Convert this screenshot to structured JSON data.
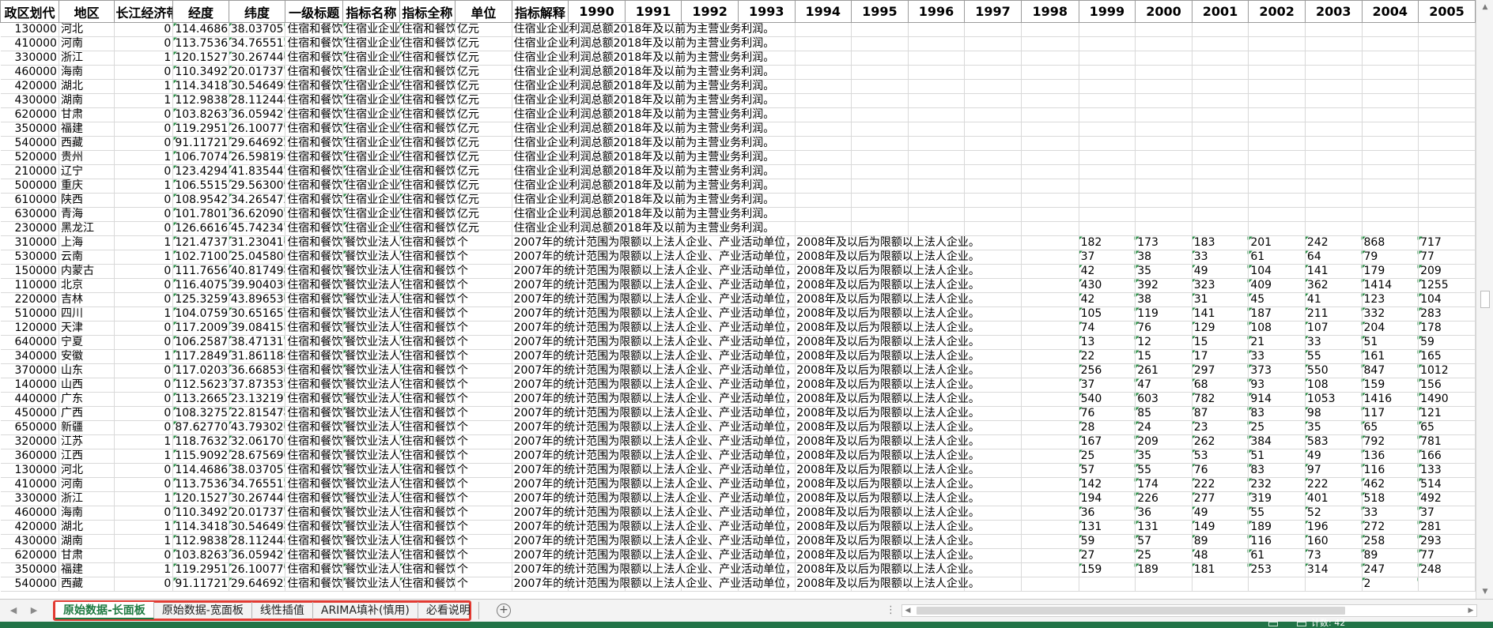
{
  "columns": [
    "政区划代",
    "地区",
    "长江经济带",
    "经度",
    "纬度",
    "一级标题",
    "指标名称",
    "指标全称",
    "单位",
    "指标解释",
    "1990",
    "1991",
    "1992",
    "1993",
    "1994",
    "1995",
    "1996",
    "1997",
    "1998",
    "1999",
    "2000",
    "2001",
    "2002",
    "2003",
    "2004",
    "2005"
  ],
  "rows": [
    [
      "130000",
      "河北",
      "0",
      "114.4686",
      "38.037057",
      "住宿和餐饮",
      "住宿业企业",
      "住宿和餐饮",
      "亿元",
      "住宿业企业利润总额2018年及以前为主营业务利润。",
      "",
      "",
      "",
      "",
      "",
      "",
      "",
      "",
      "",
      "",
      "",
      "",
      "",
      "",
      "",
      ""
    ],
    [
      "410000",
      "河南",
      "0",
      "113.7536",
      "34.765515",
      "住宿和餐饮",
      "住宿业企业",
      "住宿和餐饮",
      "亿元",
      "住宿业企业利润总额2018年及以前为主营业务利润。",
      "",
      "",
      "",
      "",
      "",
      "",
      "",
      "",
      "",
      "",
      "",
      "",
      "",
      "",
      "",
      ""
    ],
    [
      "330000",
      "浙江",
      "1",
      "120.1527",
      "30.267446",
      "住宿和餐饮",
      "住宿业企业",
      "住宿和餐饮",
      "亿元",
      "住宿业企业利润总额2018年及以前为主营业务利润。",
      "",
      "",
      "",
      "",
      "",
      "",
      "",
      "",
      "",
      "",
      "",
      "",
      "",
      "",
      "",
      ""
    ],
    [
      "460000",
      "海南",
      "0",
      "110.3492",
      "20.017377",
      "住宿和餐饮",
      "住宿业企业",
      "住宿和餐饮",
      "亿元",
      "住宿业企业利润总额2018年及以前为主营业务利润。",
      "",
      "",
      "",
      "",
      "",
      "",
      "",
      "",
      "",
      "",
      "",
      "",
      "",
      "",
      "",
      ""
    ],
    [
      "420000",
      "湖北",
      "1",
      "114.3418",
      "30.546498",
      "住宿和餐饮",
      "住宿业企业",
      "住宿和餐饮",
      "亿元",
      "住宿业企业利润总额2018年及以前为主营业务利润。",
      "",
      "",
      "",
      "",
      "",
      "",
      "",
      "",
      "",
      "",
      "",
      "",
      "",
      "",
      "",
      ""
    ],
    [
      "430000",
      "湖南",
      "1",
      "112.9838",
      "28.112444",
      "住宿和餐饮",
      "住宿业企业",
      "住宿和餐饮",
      "亿元",
      "住宿业企业利润总额2018年及以前为主营业务利润。",
      "",
      "",
      "",
      "",
      "",
      "",
      "",
      "",
      "",
      "",
      "",
      "",
      "",
      "",
      "",
      ""
    ],
    [
      "620000",
      "甘肃",
      "0",
      "103.8263",
      "36.059421",
      "住宿和餐饮",
      "住宿业企业",
      "住宿和餐饮",
      "亿元",
      "住宿业企业利润总额2018年及以前为主营业务利润。",
      "",
      "",
      "",
      "",
      "",
      "",
      "",
      "",
      "",
      "",
      "",
      "",
      "",
      "",
      "",
      ""
    ],
    [
      "350000",
      "福建",
      "0",
      "119.2951",
      "26.100779",
      "住宿和餐饮",
      "住宿业企业",
      "住宿和餐饮",
      "亿元",
      "住宿业企业利润总额2018年及以前为主营业务利润。",
      "",
      "",
      "",
      "",
      "",
      "",
      "",
      "",
      "",
      "",
      "",
      "",
      "",
      "",
      "",
      ""
    ],
    [
      "540000",
      "西藏",
      "0",
      "91.11721",
      "29.646922",
      "住宿和餐饮",
      "住宿业企业",
      "住宿和餐饮",
      "亿元",
      "住宿业企业利润总额2018年及以前为主营业务利润。",
      "",
      "",
      "",
      "",
      "",
      "",
      "",
      "",
      "",
      "",
      "",
      "",
      "",
      "",
      "",
      ""
    ],
    [
      "520000",
      "贵州",
      "1",
      "106.7074",
      "26.598194",
      "住宿和餐饮",
      "住宿业企业",
      "住宿和餐饮",
      "亿元",
      "住宿业企业利润总额2018年及以前为主营业务利润。",
      "",
      "",
      "",
      "",
      "",
      "",
      "",
      "",
      "",
      "",
      "",
      "",
      "",
      "",
      "",
      ""
    ],
    [
      "210000",
      "辽宁",
      "0",
      "123.4294",
      "41.835441",
      "住宿和餐饮",
      "住宿业企业",
      "住宿和餐饮",
      "亿元",
      "住宿业企业利润总额2018年及以前为主营业务利润。",
      "",
      "",
      "",
      "",
      "",
      "",
      "",
      "",
      "",
      "",
      "",
      "",
      "",
      "",
      "",
      ""
    ],
    [
      "500000",
      "重庆",
      "1",
      "106.5515",
      "29.563009",
      "住宿和餐饮",
      "住宿业企业",
      "住宿和餐饮",
      "亿元",
      "住宿业企业利润总额2018年及以前为主营业务利润。",
      "",
      "",
      "",
      "",
      "",
      "",
      "",
      "",
      "",
      "",
      "",
      "",
      "",
      "",
      "",
      ""
    ],
    [
      "610000",
      "陕西",
      "0",
      "108.9542",
      "34.265472",
      "住宿和餐饮",
      "住宿业企业",
      "住宿和餐饮",
      "亿元",
      "住宿业企业利润总额2018年及以前为主营业务利润。",
      "",
      "",
      "",
      "",
      "",
      "",
      "",
      "",
      "",
      "",
      "",
      "",
      "",
      "",
      "",
      ""
    ],
    [
      "630000",
      "青海",
      "0",
      "101.7801",
      "36.620901",
      "住宿和餐饮",
      "住宿业企业",
      "住宿和餐饮",
      "亿元",
      "住宿业企业利润总额2018年及以前为主营业务利润。",
      "",
      "",
      "",
      "",
      "",
      "",
      "",
      "",
      "",
      "",
      "",
      "",
      "",
      "",
      "",
      ""
    ],
    [
      "230000",
      "黑龙江",
      "0",
      "126.6616",
      "45.742347",
      "住宿和餐饮",
      "住宿业企业",
      "住宿和餐饮",
      "亿元",
      "住宿业企业利润总额2018年及以前为主营业务利润。",
      "",
      "",
      "",
      "",
      "",
      "",
      "",
      "",
      "",
      "",
      "",
      "",
      "",
      "",
      "",
      ""
    ],
    [
      "310000",
      "上海",
      "1",
      "121.4737",
      "31.230416",
      "住宿和餐饮",
      "餐饮业法人",
      "住宿和餐饮",
      "个",
      "2007年的统计范围为限额以上法人企业、产业活动单位，2008年及以后为限额以上法人企业。",
      "",
      "",
      "",
      "",
      "",
      "",
      "",
      "",
      "",
      "182",
      "173",
      "183",
      "201",
      "242",
      "868",
      "717"
    ],
    [
      "530000",
      "云南",
      "1",
      "102.7100",
      "25.045806",
      "住宿和餐饮",
      "餐饮业法人",
      "住宿和餐饮",
      "个",
      "2007年的统计范围为限额以上法人企业、产业活动单位，2008年及以后为限额以上法人企业。",
      "",
      "",
      "",
      "",
      "",
      "",
      "",
      "",
      "",
      "37",
      "38",
      "33",
      "61",
      "64",
      "79",
      "77"
    ],
    [
      "150000",
      "内蒙古",
      "0",
      "111.7656",
      "40.817498",
      "住宿和餐饮",
      "餐饮业法人",
      "住宿和餐饮",
      "个",
      "2007年的统计范围为限额以上法人企业、产业活动单位，2008年及以后为限额以上法人企业。",
      "",
      "",
      "",
      "",
      "",
      "",
      "",
      "",
      "",
      "42",
      "35",
      "49",
      "104",
      "141",
      "179",
      "209"
    ],
    [
      "110000",
      "北京",
      "0",
      "116.4075",
      "39.904030",
      "住宿和餐饮",
      "餐饮业法人",
      "住宿和餐饮",
      "个",
      "2007年的统计范围为限额以上法人企业、产业活动单位，2008年及以后为限额以上法人企业。",
      "",
      "",
      "",
      "",
      "",
      "",
      "",
      "",
      "",
      "430",
      "392",
      "323",
      "409",
      "362",
      "1414",
      "1255"
    ],
    [
      "220000",
      "吉林",
      "0",
      "125.3259",
      "43.896536",
      "住宿和餐饮",
      "餐饮业法人",
      "住宿和餐饮",
      "个",
      "2007年的统计范围为限额以上法人企业、产业活动单位，2008年及以后为限额以上法人企业。",
      "",
      "",
      "",
      "",
      "",
      "",
      "",
      "",
      "",
      "42",
      "38",
      "31",
      "45",
      "41",
      "123",
      "104"
    ],
    [
      "510000",
      "四川",
      "1",
      "104.0759",
      "30.651651",
      "住宿和餐饮",
      "餐饮业法人",
      "住宿和餐饮",
      "个",
      "2007年的统计范围为限额以上法人企业、产业活动单位，2008年及以后为限额以上法人企业。",
      "",
      "",
      "",
      "",
      "",
      "",
      "",
      "",
      "",
      "105",
      "119",
      "141",
      "187",
      "211",
      "332",
      "283"
    ],
    [
      "120000",
      "天津",
      "0",
      "117.2009",
      "39.084158",
      "住宿和餐饮",
      "餐饮业法人",
      "住宿和餐饮",
      "个",
      "2007年的统计范围为限额以上法人企业、产业活动单位，2008年及以后为限额以上法人企业。",
      "",
      "",
      "",
      "",
      "",
      "",
      "",
      "",
      "",
      "74",
      "76",
      "129",
      "108",
      "107",
      "204",
      "178"
    ],
    [
      "640000",
      "宁夏",
      "0",
      "106.2587",
      "38.471317",
      "住宿和餐饮",
      "餐饮业法人",
      "住宿和餐饮",
      "个",
      "2007年的统计范围为限额以上法人企业、产业活动单位，2008年及以后为限额以上法人企业。",
      "",
      "",
      "",
      "",
      "",
      "",
      "",
      "",
      "",
      "13",
      "12",
      "15",
      "21",
      "33",
      "51",
      "59"
    ],
    [
      "340000",
      "安徽",
      "1",
      "117.2849",
      "31.861184",
      "住宿和餐饮",
      "餐饮业法人",
      "住宿和餐饮",
      "个",
      "2007年的统计范围为限额以上法人企业、产业活动单位，2008年及以后为限额以上法人企业。",
      "",
      "",
      "",
      "",
      "",
      "",
      "",
      "",
      "",
      "22",
      "15",
      "17",
      "33",
      "55",
      "161",
      "165"
    ],
    [
      "370000",
      "山东",
      "0",
      "117.0203",
      "36.668530",
      "住宿和餐饮",
      "餐饮业法人",
      "住宿和餐饮",
      "个",
      "2007年的统计范围为限额以上法人企业、产业活动单位，2008年及以后为限额以上法人企业。",
      "",
      "",
      "",
      "",
      "",
      "",
      "",
      "",
      "",
      "256",
      "261",
      "297",
      "373",
      "550",
      "847",
      "1012"
    ],
    [
      "140000",
      "山西",
      "0",
      "112.5623",
      "37.873531",
      "住宿和餐饮",
      "餐饮业法人",
      "住宿和餐饮",
      "个",
      "2007年的统计范围为限额以上法人企业、产业活动单位，2008年及以后为限额以上法人企业。",
      "",
      "",
      "",
      "",
      "",
      "",
      "",
      "",
      "",
      "37",
      "47",
      "68",
      "93",
      "108",
      "159",
      "156"
    ],
    [
      "440000",
      "广东",
      "0",
      "113.2665",
      "23.132191",
      "住宿和餐饮",
      "餐饮业法人",
      "住宿和餐饮",
      "个",
      "2007年的统计范围为限额以上法人企业、产业活动单位，2008年及以后为限额以上法人企业。",
      "",
      "",
      "",
      "",
      "",
      "",
      "",
      "",
      "",
      "540",
      "603",
      "782",
      "914",
      "1053",
      "1416",
      "1490"
    ],
    [
      "450000",
      "广西",
      "0",
      "108.3275",
      "22.815478",
      "住宿和餐饮",
      "餐饮业法人",
      "住宿和餐饮",
      "个",
      "2007年的统计范围为限额以上法人企业、产业活动单位，2008年及以后为限额以上法人企业。",
      "",
      "",
      "",
      "",
      "",
      "",
      "",
      "",
      "",
      "76",
      "85",
      "87",
      "83",
      "98",
      "117",
      "121"
    ],
    [
      "650000",
      "新疆",
      "0",
      "87.62770",
      "43.793026",
      "住宿和餐饮",
      "餐饮业法人",
      "住宿和餐饮",
      "个",
      "2007年的统计范围为限额以上法人企业、产业活动单位，2008年及以后为限额以上法人企业。",
      "",
      "",
      "",
      "",
      "",
      "",
      "",
      "",
      "",
      "28",
      "24",
      "23",
      "25",
      "35",
      "65",
      "65"
    ],
    [
      "320000",
      "江苏",
      "1",
      "118.7632",
      "32.061707",
      "住宿和餐饮",
      "餐饮业法人",
      "住宿和餐饮",
      "个",
      "2007年的统计范围为限额以上法人企业、产业活动单位，2008年及以后为限额以上法人企业。",
      "",
      "",
      "",
      "",
      "",
      "",
      "",
      "",
      "",
      "167",
      "209",
      "262",
      "384",
      "583",
      "792",
      "781"
    ],
    [
      "360000",
      "江西",
      "1",
      "115.9092",
      "28.675696",
      "住宿和餐饮",
      "餐饮业法人",
      "住宿和餐饮",
      "个",
      "2007年的统计范围为限额以上法人企业、产业活动单位，2008年及以后为限额以上法人企业。",
      "",
      "",
      "",
      "",
      "",
      "",
      "",
      "",
      "",
      "25",
      "35",
      "53",
      "51",
      "49",
      "136",
      "166"
    ],
    [
      "130000",
      "河北",
      "0",
      "114.4686",
      "38.037057",
      "住宿和餐饮",
      "餐饮业法人",
      "住宿和餐饮",
      "个",
      "2007年的统计范围为限额以上法人企业、产业活动单位，2008年及以后为限额以上法人企业。",
      "",
      "",
      "",
      "",
      "",
      "",
      "",
      "",
      "",
      "57",
      "55",
      "76",
      "83",
      "97",
      "116",
      "133"
    ],
    [
      "410000",
      "河南",
      "0",
      "113.7536",
      "34.765515",
      "住宿和餐饮",
      "餐饮业法人",
      "住宿和餐饮",
      "个",
      "2007年的统计范围为限额以上法人企业、产业活动单位，2008年及以后为限额以上法人企业。",
      "",
      "",
      "",
      "",
      "",
      "",
      "",
      "",
      "",
      "142",
      "174",
      "222",
      "232",
      "222",
      "462",
      "514"
    ],
    [
      "330000",
      "浙江",
      "1",
      "120.1527",
      "30.267446",
      "住宿和餐饮",
      "餐饮业法人",
      "住宿和餐饮",
      "个",
      "2007年的统计范围为限额以上法人企业、产业活动单位，2008年及以后为限额以上法人企业。",
      "",
      "",
      "",
      "",
      "",
      "",
      "",
      "",
      "",
      "194",
      "226",
      "277",
      "319",
      "401",
      "518",
      "492"
    ],
    [
      "460000",
      "海南",
      "0",
      "110.3492",
      "20.017377",
      "住宿和餐饮",
      "餐饮业法人",
      "住宿和餐饮",
      "个",
      "2007年的统计范围为限额以上法人企业、产业活动单位，2008年及以后为限额以上法人企业。",
      "",
      "",
      "",
      "",
      "",
      "",
      "",
      "",
      "",
      "36",
      "36",
      "49",
      "55",
      "52",
      "33",
      "37"
    ],
    [
      "420000",
      "湖北",
      "1",
      "114.3418",
      "30.546498",
      "住宿和餐饮",
      "餐饮业法人",
      "住宿和餐饮",
      "个",
      "2007年的统计范围为限额以上法人企业、产业活动单位，2008年及以后为限额以上法人企业。",
      "",
      "",
      "",
      "",
      "",
      "",
      "",
      "",
      "",
      "131",
      "131",
      "149",
      "189",
      "196",
      "272",
      "281"
    ],
    [
      "430000",
      "湖南",
      "1",
      "112.9838",
      "28.112444",
      "住宿和餐饮",
      "餐饮业法人",
      "住宿和餐饮",
      "个",
      "2007年的统计范围为限额以上法人企业、产业活动单位，2008年及以后为限额以上法人企业。",
      "",
      "",
      "",
      "",
      "",
      "",
      "",
      "",
      "",
      "59",
      "57",
      "89",
      "116",
      "160",
      "258",
      "293"
    ],
    [
      "620000",
      "甘肃",
      "0",
      "103.8263",
      "36.059421",
      "住宿和餐饮",
      "餐饮业法人",
      "住宿和餐饮",
      "个",
      "2007年的统计范围为限额以上法人企业、产业活动单位，2008年及以后为限额以上法人企业。",
      "",
      "",
      "",
      "",
      "",
      "",
      "",
      "",
      "",
      "27",
      "25",
      "48",
      "61",
      "73",
      "89",
      "77"
    ],
    [
      "350000",
      "福建",
      "1",
      "119.2951",
      "26.100779",
      "住宿和餐饮",
      "餐饮业法人",
      "住宿和餐饮",
      "个",
      "2007年的统计范围为限额以上法人企业、产业活动单位，2008年及以后为限额以上法人企业。",
      "",
      "",
      "",
      "",
      "",
      "",
      "",
      "",
      "",
      "159",
      "189",
      "181",
      "253",
      "314",
      "247",
      "248"
    ],
    [
      "540000",
      "西藏",
      "0",
      "91.11721",
      "29.646922",
      "住宿和餐饮",
      "餐饮业法人",
      "住宿和餐饮",
      "个",
      "2007年的统计范围为限额以上法人企业、产业活动单位，2008年及以后为限额以上法人企业。",
      "",
      "",
      "",
      "",
      "",
      "",
      "",
      "",
      "",
      "",
      "",
      "",
      "",
      "",
      "2",
      ""
    ]
  ],
  "tabs": [
    "原始数据-长面板",
    "原始数据-宽面板",
    "线性插值",
    "ARIMA填补(慎用)",
    "必看说明"
  ],
  "active_tab": 0,
  "add_sheet_label": "+",
  "status_text": "计数: 42",
  "colors": {
    "accent": "#217346",
    "tab_outline": "#e23a32",
    "indicator": "#1e8a3c"
  },
  "icons": [
    "nav-left-icon",
    "nav-right-icon",
    "add-sheet-icon",
    "scroll-up-icon",
    "scroll-down-icon",
    "scroll-left-icon",
    "scroll-right-icon"
  ]
}
